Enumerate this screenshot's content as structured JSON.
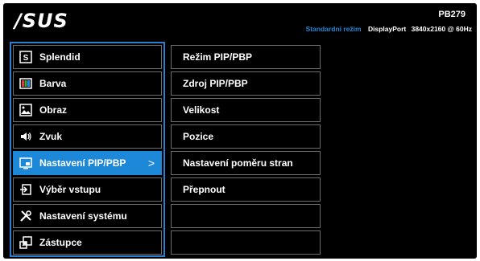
{
  "header": {
    "logo": "/SUS",
    "model": "PB279",
    "mode": "Standardní režim",
    "port": "DisplayPort",
    "resolution": "3840x2160 @ 60Hz"
  },
  "menu": [
    {
      "label": "Splendid",
      "icon": "splendid-icon"
    },
    {
      "label": "Barva",
      "icon": "color-icon"
    },
    {
      "label": "Obraz",
      "icon": "image-icon"
    },
    {
      "label": "Zvuk",
      "icon": "speaker-icon"
    },
    {
      "label": "Nastavení PIP/PBP",
      "icon": "pip-icon",
      "active": true,
      "chevron": ">"
    },
    {
      "label": "Výběr vstupu",
      "icon": "input-select-icon"
    },
    {
      "label": "Nastavení systému",
      "icon": "system-settings-icon"
    },
    {
      "label": "Zástupce",
      "icon": "shortcut-icon"
    }
  ],
  "submenu": [
    "Režim PIP/PBP",
    "Zdroj PIP/PBP",
    "Velikost",
    "Pozice",
    "Nastavení poměru stran",
    "Přepnout",
    "",
    ""
  ],
  "colors": {
    "background": "#000000",
    "accent": "#1e88d8",
    "border": "#6e6e6e",
    "text": "#ffffff"
  }
}
